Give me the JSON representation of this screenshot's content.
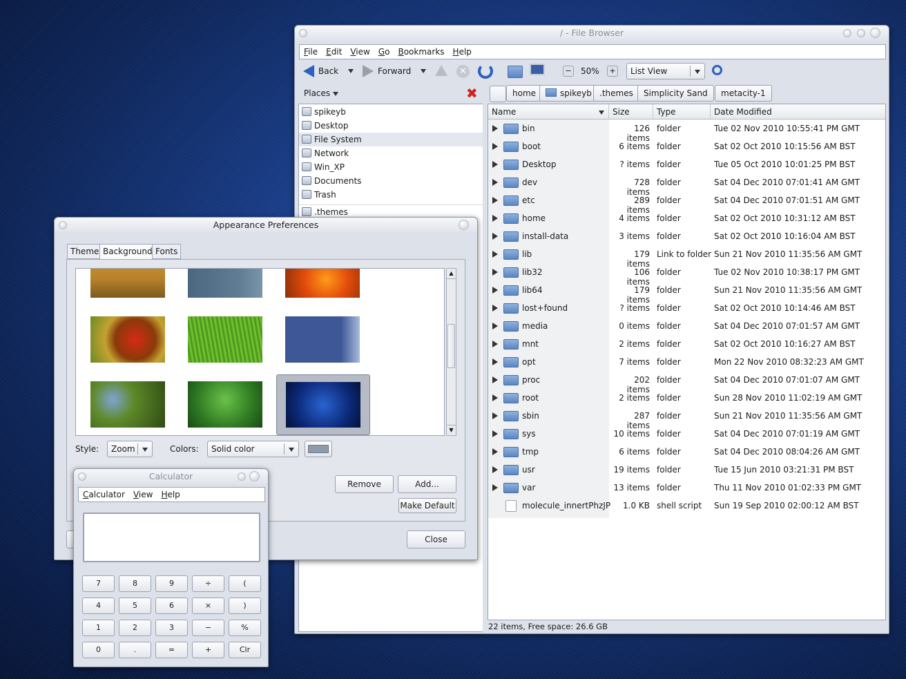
{
  "file_browser": {
    "title": "/ - File Browser",
    "menu": [
      "File",
      "Edit",
      "View",
      "Go",
      "Bookmarks",
      "Help"
    ],
    "toolbar": {
      "back": "Back",
      "forward": "Forward",
      "zoom": "50%",
      "view_mode": "List View"
    },
    "places_label": "Places",
    "places": [
      {
        "label": "spikeyb",
        "icon": "home-folder-icon"
      },
      {
        "label": "Desktop",
        "icon": "desktop-icon"
      },
      {
        "label": "File System",
        "icon": "harddisk-icon"
      },
      {
        "label": "Network",
        "icon": "network-icon"
      },
      {
        "label": "Win_XP",
        "icon": "drive-icon"
      },
      {
        "label": "Documents",
        "icon": "drive-icon"
      },
      {
        "label": "Trash",
        "icon": "trash-icon"
      },
      {
        "label": ".themes",
        "icon": "folder-icon"
      }
    ],
    "breadcrumbs": [
      "home",
      "spikeyb",
      ".themes",
      "Simplicity Sand",
      "metacity-1"
    ],
    "columns": [
      "Name",
      "Size",
      "Type",
      "Date Modified"
    ],
    "files": [
      {
        "name": "bin",
        "size": "126 items",
        "type": "folder",
        "date": "Tue 02 Nov 2010 10:55:41 PM GMT"
      },
      {
        "name": "boot",
        "size": "6 items",
        "type": "folder",
        "date": "Sat 02 Oct 2010 10:15:56 AM BST"
      },
      {
        "name": "Desktop",
        "size": "? items",
        "type": "folder",
        "date": "Tue 05 Oct 2010 10:01:25 PM BST"
      },
      {
        "name": "dev",
        "size": "728 items",
        "type": "folder",
        "date": "Sat 04 Dec 2010 07:01:41 AM GMT"
      },
      {
        "name": "etc",
        "size": "289 items",
        "type": "folder",
        "date": "Sat 04 Dec 2010 07:01:51 AM GMT"
      },
      {
        "name": "home",
        "size": "4 items",
        "type": "folder",
        "date": "Sat 02 Oct 2010 10:31:12 AM BST"
      },
      {
        "name": "install-data",
        "size": "3 items",
        "type": "folder",
        "date": "Sat 02 Oct 2010 10:16:04 AM BST"
      },
      {
        "name": "lib",
        "size": "179 items",
        "type": "Link to folder",
        "date": "Sun 21 Nov 2010 11:35:56 AM GMT"
      },
      {
        "name": "lib32",
        "size": "106 items",
        "type": "folder",
        "date": "Tue 02 Nov 2010 10:38:17 PM GMT"
      },
      {
        "name": "lib64",
        "size": "179 items",
        "type": "folder",
        "date": "Sun 21 Nov 2010 11:35:56 AM GMT"
      },
      {
        "name": "lost+found",
        "size": "? items",
        "type": "folder",
        "date": "Sat 02 Oct 2010 10:14:46 AM BST"
      },
      {
        "name": "media",
        "size": "0 items",
        "type": "folder",
        "date": "Sat 04 Dec 2010 07:01:57 AM GMT"
      },
      {
        "name": "mnt",
        "size": "2 items",
        "type": "folder",
        "date": "Sat 02 Oct 2010 10:16:27 AM BST"
      },
      {
        "name": "opt",
        "size": "7 items",
        "type": "folder",
        "date": "Mon 22 Nov 2010 08:32:23 AM GMT"
      },
      {
        "name": "proc",
        "size": "202 items",
        "type": "folder",
        "date": "Sat 04 Dec 2010 07:01:07 AM GMT"
      },
      {
        "name": "root",
        "size": "2 items",
        "type": "folder",
        "date": "Sun 28 Nov 2010 11:02:19 AM GMT"
      },
      {
        "name": "sbin",
        "size": "287 items",
        "type": "folder",
        "date": "Sun 21 Nov 2010 11:35:56 AM GMT"
      },
      {
        "name": "sys",
        "size": "10 items",
        "type": "folder",
        "date": "Sat 04 Dec 2010 07:01:19 AM GMT"
      },
      {
        "name": "tmp",
        "size": "6 items",
        "type": "folder",
        "date": "Sat 04 Dec 2010 08:04:26 AM GMT"
      },
      {
        "name": "usr",
        "size": "19 items",
        "type": "folder",
        "date": "Tue 15 Jun 2010 03:21:31 PM BST"
      },
      {
        "name": "var",
        "size": "13 items",
        "type": "folder",
        "date": "Thu 11 Nov 2010 01:02:33 PM GMT"
      },
      {
        "name": "molecule_innertPhzJP",
        "size": "1.0 KB",
        "type": "shell script",
        "date": "Sun 19 Sep 2010 02:00:12 AM BST"
      }
    ],
    "status": "22 items, Free space: 26.6 GB"
  },
  "appearance": {
    "title": "Appearance Preferences",
    "tabs": [
      "Theme",
      "Background",
      "Fonts"
    ],
    "style_label": "Style:",
    "style_value": "Zoom",
    "colors_label": "Colors:",
    "colors_value": "Solid color",
    "color_swatch": "#8f9bab",
    "remove": "Remove",
    "add": "Add...",
    "make_default": "Make Default",
    "close": "Close"
  },
  "calculator": {
    "title": "Calculator",
    "menu": [
      "Calculator",
      "View",
      "Help"
    ],
    "display": "",
    "keys": [
      [
        "7",
        "8",
        "9",
        "÷",
        "("
      ],
      [
        "4",
        "5",
        "6",
        "×",
        ")"
      ],
      [
        "1",
        "2",
        "3",
        "−",
        "%"
      ],
      [
        "0",
        ".",
        "=",
        "+",
        "Clr"
      ]
    ]
  }
}
